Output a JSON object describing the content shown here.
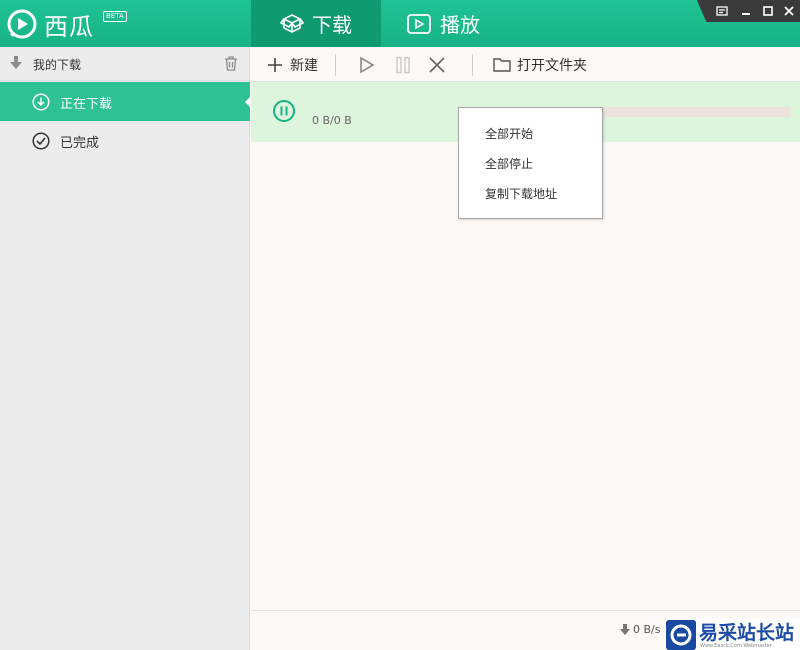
{
  "app": {
    "name": "西瓜",
    "badge": "BETA"
  },
  "main_tabs": {
    "download": "下载",
    "play": "播放"
  },
  "sidebar": {
    "header": "我的下载",
    "items": [
      {
        "label": "正在下载",
        "active": true
      },
      {
        "label": "已完成",
        "active": false
      }
    ]
  },
  "toolbar": {
    "new_label": "新建",
    "open_folder_label": "打开文件夹"
  },
  "task": {
    "size_text": "0 B/0 B",
    "progress": 0
  },
  "context_menu": {
    "items": [
      "全部开始",
      "全部停止",
      "复制下载地址"
    ]
  },
  "status": {
    "speed": "0 B/s"
  },
  "watermark": {
    "text": "易采站长站",
    "sub": "Www.Easck.Com  Webmaster"
  },
  "colors": {
    "brand": "#1fc394",
    "active_tab": "#109a6f",
    "sidebar_active": "#2ec192",
    "task_row": "#ddf5dc"
  }
}
